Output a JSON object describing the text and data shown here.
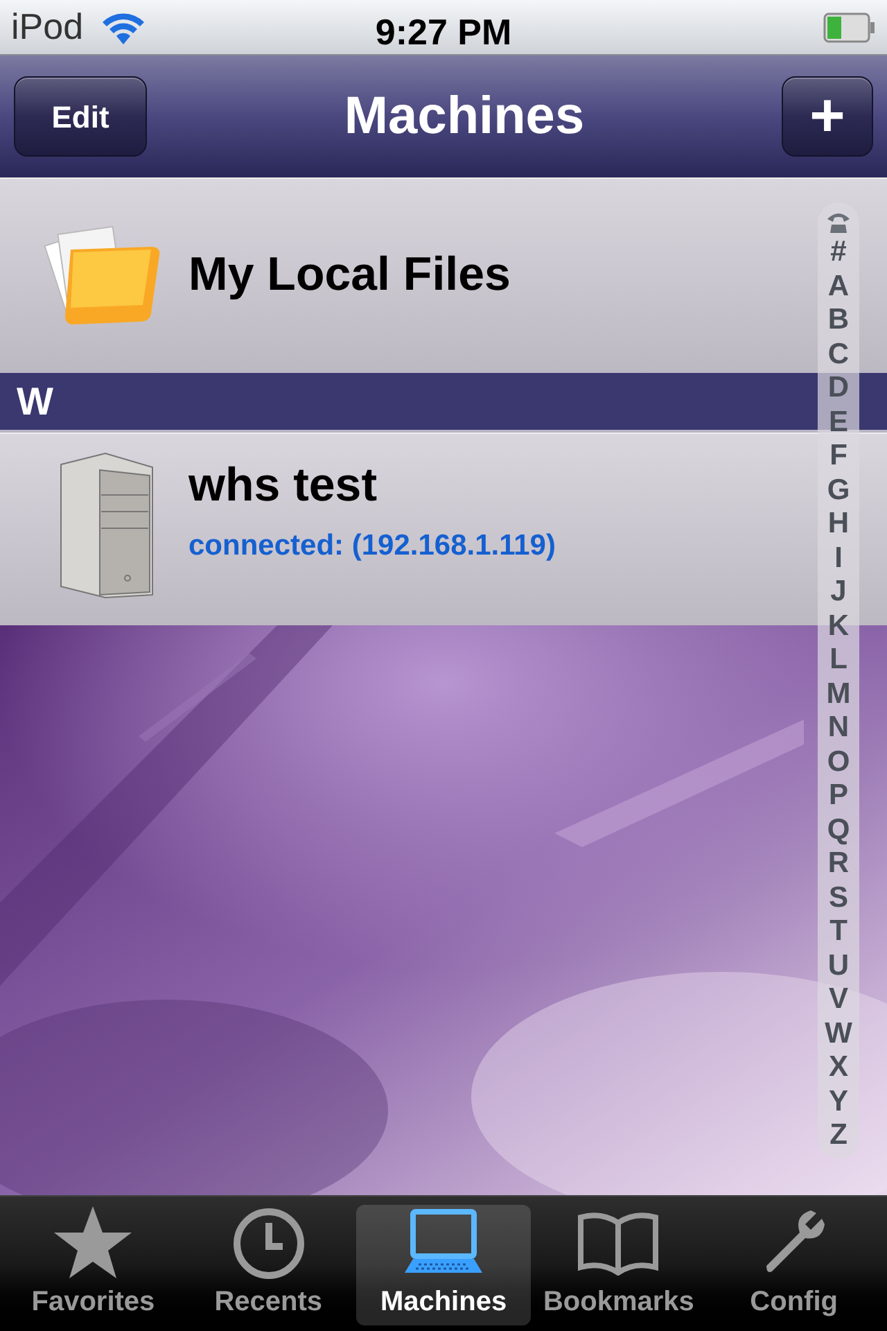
{
  "status_bar": {
    "carrier": "iPod",
    "time": "9:27 PM"
  },
  "nav_bar": {
    "left_button": "Edit",
    "title": "Machines",
    "right_button": "+"
  },
  "list": [
    {
      "kind": "folder",
      "title": "My Local Files"
    },
    {
      "kind": "header",
      "title": "W"
    },
    {
      "kind": "machine",
      "title": "whs test",
      "subtitle": "connected: (192.168.1.119)"
    }
  ],
  "index": [
    "#",
    "A",
    "B",
    "C",
    "D",
    "E",
    "F",
    "G",
    "H",
    "I",
    "J",
    "K",
    "L",
    "M",
    "N",
    "O",
    "P",
    "Q",
    "R",
    "S",
    "T",
    "U",
    "V",
    "W",
    "X",
    "Y",
    "Z"
  ],
  "tabs": [
    {
      "label": "Favorites",
      "selected": false
    },
    {
      "label": "Recents",
      "selected": false
    },
    {
      "label": "Machines",
      "selected": true
    },
    {
      "label": "Bookmarks",
      "selected": false
    },
    {
      "label": "Config",
      "selected": false
    }
  ]
}
